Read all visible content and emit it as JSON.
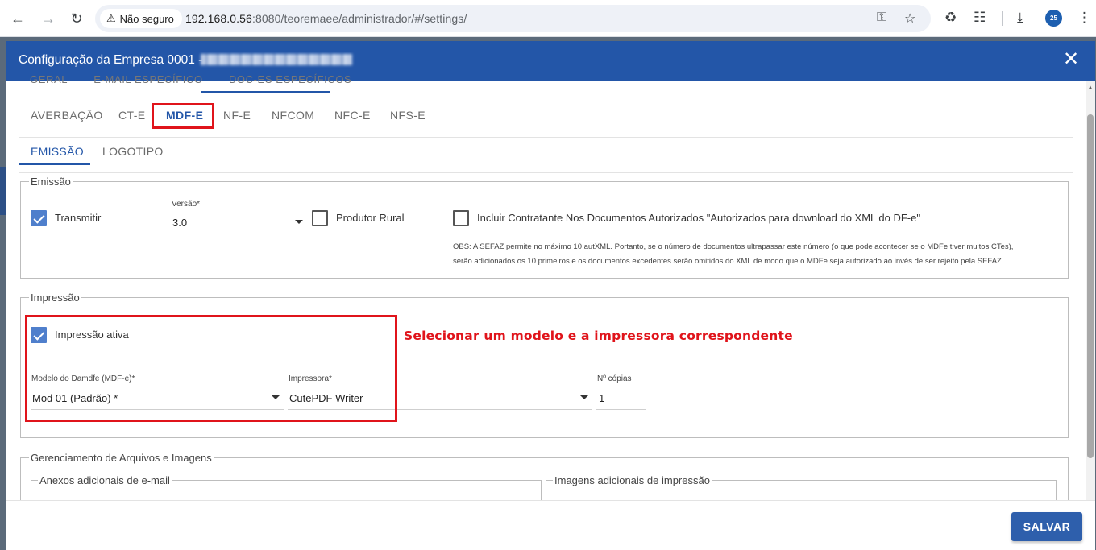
{
  "browser": {
    "security_label": "Não seguro",
    "url_host": "192.168.0.56",
    "url_rest": ":8080/teoremaee/administrador/#/settings/",
    "profile_initials": "25"
  },
  "dialog": {
    "title": "Configuração da Empresa 0001 -",
    "close_label": "✕",
    "top_tabs": [
      "GERAL",
      "E-MAIL ESPECÍFICO",
      "DOC-ES ESPECÍFICOS"
    ],
    "doc_tabs": [
      "AVERBAÇÃO",
      "CT-E",
      "MDF-E",
      "NF-E",
      "NFCOM",
      "NFC-E",
      "NFS-E"
    ],
    "sub_tabs": [
      "EMISSÃO",
      "LOGOTIPO"
    ],
    "emissao": {
      "legend": "Emissão",
      "transmitir_label": "Transmitir",
      "transmitir_checked": true,
      "versao_label": "Versão*",
      "versao_value": "3.0",
      "produtor_rural_label": "Produtor Rural",
      "produtor_rural_checked": false,
      "incluir_contratante_label": "Incluir Contratante Nos Documentos Autorizados \"Autorizados para download do XML do DF-e\"",
      "incluir_contratante_checked": false,
      "obs_line1": "OBS: A SEFAZ permite no máximo 10 autXML. Portanto, se o número de documentos ultrapassar este número (o que pode acontecer se o MDFe tiver muitos CTes),",
      "obs_line2": "serão adicionados os 10 primeiros e os documentos excedentes serão omitidos do XML de modo que o MDFe seja autorizado ao invés de ser rejeito pela SEFAZ"
    },
    "impressao": {
      "legend": "Impressão",
      "ativa_label": "Impressão ativa",
      "ativa_checked": true,
      "modelo_label": "Modelo do Damdfe (MDF-e)*",
      "modelo_value": "Mod 01 (Padrão) *",
      "impressora_label": "Impressora*",
      "impressora_value": "CutePDF Writer",
      "copias_label": "Nº cópias",
      "copias_value": "1"
    },
    "annotation": "Selecionar um modelo e a impressora correspondente",
    "arquivos": {
      "legend": "Gerenciamento de Arquivos e Imagens",
      "anexos_legend": "Anexos adicionais de e-mail",
      "imagens_legend": "Imagens adicionais de impressão"
    },
    "save_label": "SALVAR"
  },
  "colors": {
    "header": "#2356a8",
    "accent": "#2356a8",
    "checkbox": "#4f7fcc",
    "highlight": "#e0141b",
    "save_button": "#2e5fac"
  }
}
